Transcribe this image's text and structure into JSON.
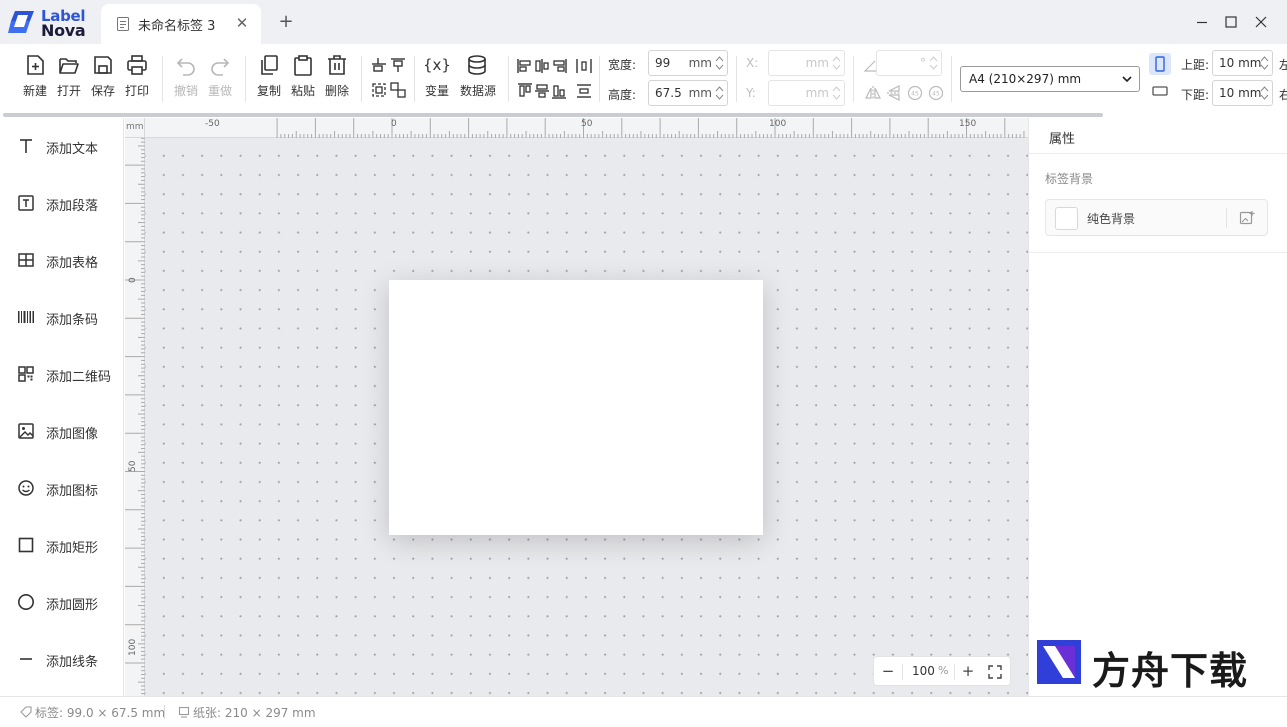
{
  "app": {
    "logo_line1": "Label",
    "logo_line2": "Nova",
    "brand_color": "#2e55d6"
  },
  "tab": {
    "title": "未命名标签 3",
    "close": "✕",
    "new": "+"
  },
  "toolbar": {
    "new_label": "新建",
    "open_label": "打开",
    "save_label": "保存",
    "print_label": "打印",
    "undo_label": "撤销",
    "redo_label": "重做",
    "copy_label": "复制",
    "paste_label": "粘贴",
    "delete_label": "删除",
    "variable_label": "变量",
    "datasource_label": "数据源",
    "width_label": "宽度:",
    "width_value": "99",
    "width_unit": "mm",
    "height_label": "高度:",
    "height_value": "67.5",
    "height_unit": "mm",
    "x_label": "X:",
    "x_unit": "mm",
    "y_label": "Y:",
    "y_unit": "mm",
    "angle_unit": "°",
    "paper_select": "A4 (210×297) mm",
    "top_margin_label": "上距:",
    "top_margin_value": "10 mm",
    "bottom_margin_label": "下距:",
    "bottom_margin_value": "10 mm",
    "cut1": "左",
    "cut2": "右"
  },
  "sidebar": {
    "items": [
      {
        "label": "添加文本",
        "icon": "text-icon"
      },
      {
        "label": "添加段落",
        "icon": "paragraph-icon"
      },
      {
        "label": "添加表格",
        "icon": "table-icon"
      },
      {
        "label": "添加条码",
        "icon": "barcode-icon"
      },
      {
        "label": "添加二维码",
        "icon": "qrcode-icon"
      },
      {
        "label": "添加图像",
        "icon": "image-icon"
      },
      {
        "label": "添加图标",
        "icon": "smiley-icon"
      },
      {
        "label": "添加矩形",
        "icon": "rectangle-icon"
      },
      {
        "label": "添加圆形",
        "icon": "circle-icon"
      },
      {
        "label": "添加线条",
        "icon": "line-icon"
      }
    ]
  },
  "canvas": {
    "unit": "mm",
    "ruler_top": [
      "-50",
      "0",
      "50",
      "100",
      "150"
    ],
    "ruler_left": [
      "0",
      "50",
      "100"
    ],
    "zoom_value": "100",
    "zoom_unit": "%",
    "zoom_out": "−",
    "zoom_in": "+"
  },
  "properties": {
    "title": "属性",
    "section": "标签背景",
    "background": "纯色背景"
  },
  "watermark": {
    "text": "方舟下载"
  },
  "status": {
    "label_size": "标签: 99.0 × 67.5 mm",
    "paper_size": "纸张: 210 × 297 mm"
  }
}
